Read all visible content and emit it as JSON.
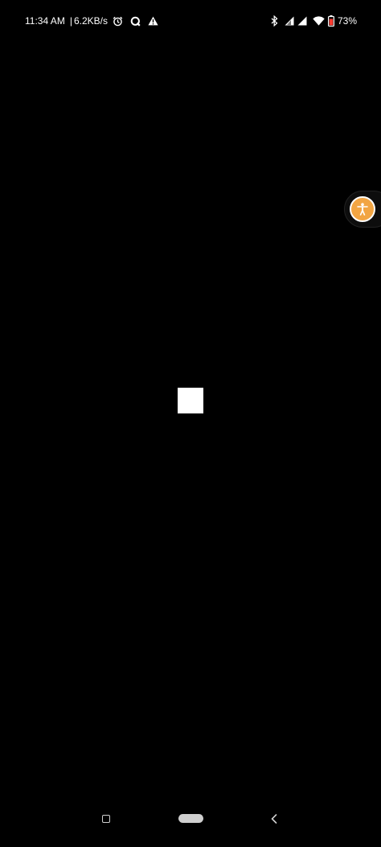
{
  "status_bar": {
    "time": "11:34 AM",
    "separator": "|",
    "network_speed": "6.2KB/s",
    "battery_percent": "73",
    "battery_unit": "%",
    "icons_left": [
      "alarm-icon",
      "q-app-icon",
      "warning-icon"
    ],
    "icons_right": [
      "bluetooth-icon",
      "signal-icon",
      "signal-icon",
      "wifi-icon",
      "battery-icon"
    ]
  },
  "floating_button": {
    "icon": "accessibility-icon",
    "color": "#f2a543"
  },
  "content": {
    "background_color": "#000000",
    "square_color": "#ffffff"
  },
  "nav_bar": {
    "buttons": [
      "recents-button",
      "home-button",
      "back-button"
    ]
  }
}
